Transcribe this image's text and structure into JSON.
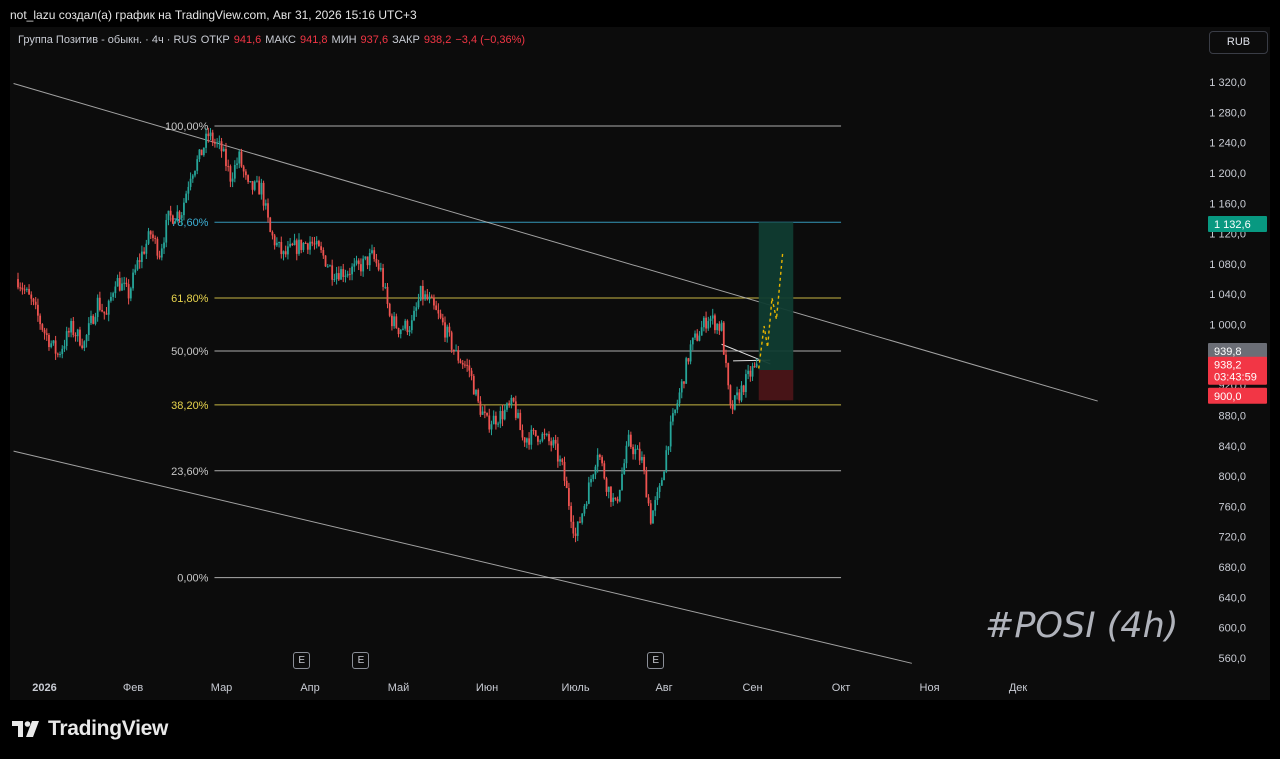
{
  "header": {
    "caption": "not_lazu создал(а) график на TradingView.com, Авг 31, 2026 15:16 UTC+3"
  },
  "legend": {
    "symbol": "Группа Позитив - обыкн. · 4ч · RUS",
    "open_label": "ОТКР",
    "open": "941,6",
    "high_label": "МАКС",
    "high": "941,8",
    "low_label": "МИН",
    "low": "937,6",
    "close_label": "ЗАКР",
    "close": "938,2",
    "change": "−3,4 (−0,36%)"
  },
  "currency_button": "RUB",
  "watermark": "#POSI (4h)",
  "footer": {
    "logo_text": "TradingView"
  },
  "earnings_badges": [
    {
      "label": "E",
      "month_index": 3.2
    },
    {
      "label": "E",
      "month_index": 3.87
    },
    {
      "label": "E",
      "month_index": 7.2
    }
  ],
  "colors": {
    "up": "#26a69a",
    "down": "#ef5350",
    "fib_yellow": "#e8d44d",
    "fib_blue": "#3db0d6",
    "fib_white": "#d0d0d0",
    "last_price": "#f23645",
    "target_tag": "#089981",
    "reward_zone": "#103c31",
    "risk_zone": "#4b1518"
  },
  "chart_data": {
    "type": "candlestick",
    "timeframe": "4ч",
    "ylim": [
      545,
      1345
    ],
    "x_range_months": [
      -0.05,
      11.3
    ],
    "price_ticks": [
      "1 320,0",
      "1 280,0",
      "1 240,0",
      "1 200,0",
      "1 160,0",
      "1 120,0",
      "1 080,0",
      "1 040,0",
      "1 000,0",
      "960,0",
      "920,0",
      "880,0",
      "840,0",
      "800,0",
      "760,0",
      "720,0",
      "680,0",
      "640,0",
      "600,0",
      "560,0"
    ],
    "price_tick_values": [
      1320,
      1280,
      1240,
      1200,
      1160,
      1120,
      1080,
      1040,
      1000,
      960,
      920,
      880,
      840,
      800,
      760,
      720,
      680,
      640,
      600,
      560
    ],
    "time_labels": [
      {
        "label": "2026",
        "m": 0.3
      },
      {
        "label": "Фев",
        "m": 1.3
      },
      {
        "label": "Мар",
        "m": 2.3
      },
      {
        "label": "Апр",
        "m": 3.3
      },
      {
        "label": "Май",
        "m": 4.3
      },
      {
        "label": "Июн",
        "m": 5.3
      },
      {
        "label": "Июль",
        "m": 6.3
      },
      {
        "label": "Авг",
        "m": 7.3
      },
      {
        "label": "Сен",
        "m": 8.3
      },
      {
        "label": "Окт",
        "m": 9.3
      },
      {
        "label": "Ноя",
        "m": 10.3
      },
      {
        "label": "Дек",
        "m": 11.3
      }
    ],
    "fibonacci": [
      {
        "label": "100,00%",
        "price": 1262,
        "color": "#c8c8c8"
      },
      {
        "label": "78,60%",
        "price": 1135,
        "color": "#3db0d6"
      },
      {
        "label": "61,80%",
        "price": 1035,
        "color": "#e8d44d"
      },
      {
        "label": "50,00%",
        "price": 965,
        "color": "#c8c8c8"
      },
      {
        "label": "38,20%",
        "price": 894,
        "color": "#e8d44d"
      },
      {
        "label": "23,60%",
        "price": 807,
        "color": "#c8c8c8"
      },
      {
        "label": "0,00%",
        "price": 666,
        "color": "#c8c8c8"
      }
    ],
    "fib_range_months": [
      2.22,
      9.3
    ],
    "trend_channel": {
      "upper": [
        {
          "m": -0.05,
          "p": 1318
        },
        {
          "m": 12.2,
          "p": 899
        }
      ],
      "lower": [
        {
          "m": -0.05,
          "p": 833
        },
        {
          "m": 10.1,
          "p": 553
        }
      ]
    },
    "triangle_lines": [
      [
        {
          "m": 7.95,
          "p": 974
        },
        {
          "m": 8.5,
          "p": 948
        }
      ],
      [
        {
          "m": 8.08,
          "p": 952
        },
        {
          "m": 8.5,
          "p": 953
        }
      ]
    ],
    "position": {
      "m_start": 8.37,
      "m_end": 8.76,
      "entry": 940,
      "target": 1135,
      "stop": 900
    },
    "projection": [
      {
        "m": 8.37,
        "p": 942
      },
      {
        "m": 8.43,
        "p": 998
      },
      {
        "m": 8.47,
        "p": 970
      },
      {
        "m": 8.52,
        "p": 1035
      },
      {
        "m": 8.57,
        "p": 1007
      },
      {
        "m": 8.64,
        "p": 1094
      }
    ],
    "price_tags": [
      {
        "label": "1 132,6",
        "price": 1132.6,
        "color": "#089981"
      },
      {
        "label": "939,8",
        "price": 965,
        "color": "#6b6e76"
      },
      {
        "label": "938,2",
        "price": 947,
        "color": "#f23645",
        "sub": "03:43:59"
      },
      {
        "label": "900,0",
        "price": 906,
        "color": "#f23645"
      }
    ],
    "price_path": [
      [
        0.0,
        1060
      ],
      [
        0.15,
        1030
      ],
      [
        0.3,
        990
      ],
      [
        0.45,
        960
      ],
      [
        0.6,
        995
      ],
      [
        0.75,
        975
      ],
      [
        0.9,
        1030
      ],
      [
        1.0,
        1010
      ],
      [
        1.1,
        1060
      ],
      [
        1.25,
        1040
      ],
      [
        1.35,
        1080
      ],
      [
        1.5,
        1120
      ],
      [
        1.6,
        1095
      ],
      [
        1.7,
        1140
      ],
      [
        1.85,
        1150
      ],
      [
        1.95,
        1200
      ],
      [
        2.05,
        1220
      ],
      [
        2.15,
        1250
      ],
      [
        2.3,
        1230
      ],
      [
        2.4,
        1195
      ],
      [
        2.5,
        1220
      ],
      [
        2.6,
        1180
      ],
      [
        2.75,
        1180
      ],
      [
        2.85,
        1120
      ],
      [
        3.0,
        1090
      ],
      [
        3.1,
        1100
      ],
      [
        3.3,
        1110
      ],
      [
        3.45,
        1090
      ],
      [
        3.55,
        1070
      ],
      [
        3.7,
        1070
      ],
      [
        3.85,
        1075
      ],
      [
        4.0,
        1090
      ],
      [
        4.1,
        1070
      ],
      [
        4.2,
        1010
      ],
      [
        4.3,
        995
      ],
      [
        4.45,
        1000
      ],
      [
        4.55,
        1040
      ],
      [
        4.65,
        1030
      ],
      [
        4.8,
        1000
      ],
      [
        4.95,
        960
      ],
      [
        5.1,
        940
      ],
      [
        5.2,
        895
      ],
      [
        5.3,
        870
      ],
      [
        5.45,
        880
      ],
      [
        5.6,
        895
      ],
      [
        5.7,
        850
      ],
      [
        5.9,
        855
      ],
      [
        6.05,
        840
      ],
      [
        6.15,
        810
      ],
      [
        6.3,
        720
      ],
      [
        6.45,
        785
      ],
      [
        6.55,
        835
      ],
      [
        6.65,
        790
      ],
      [
        6.75,
        760
      ],
      [
        6.9,
        845
      ],
      [
        7.05,
        820
      ],
      [
        7.15,
        745
      ],
      [
        7.25,
        780
      ],
      [
        7.35,
        850
      ],
      [
        7.5,
        920
      ],
      [
        7.6,
        970
      ],
      [
        7.7,
        990
      ],
      [
        7.8,
        1010
      ],
      [
        7.95,
        995
      ],
      [
        8.05,
        885
      ],
      [
        8.2,
        920
      ],
      [
        8.3,
        940
      ],
      [
        8.37,
        940
      ]
    ]
  }
}
